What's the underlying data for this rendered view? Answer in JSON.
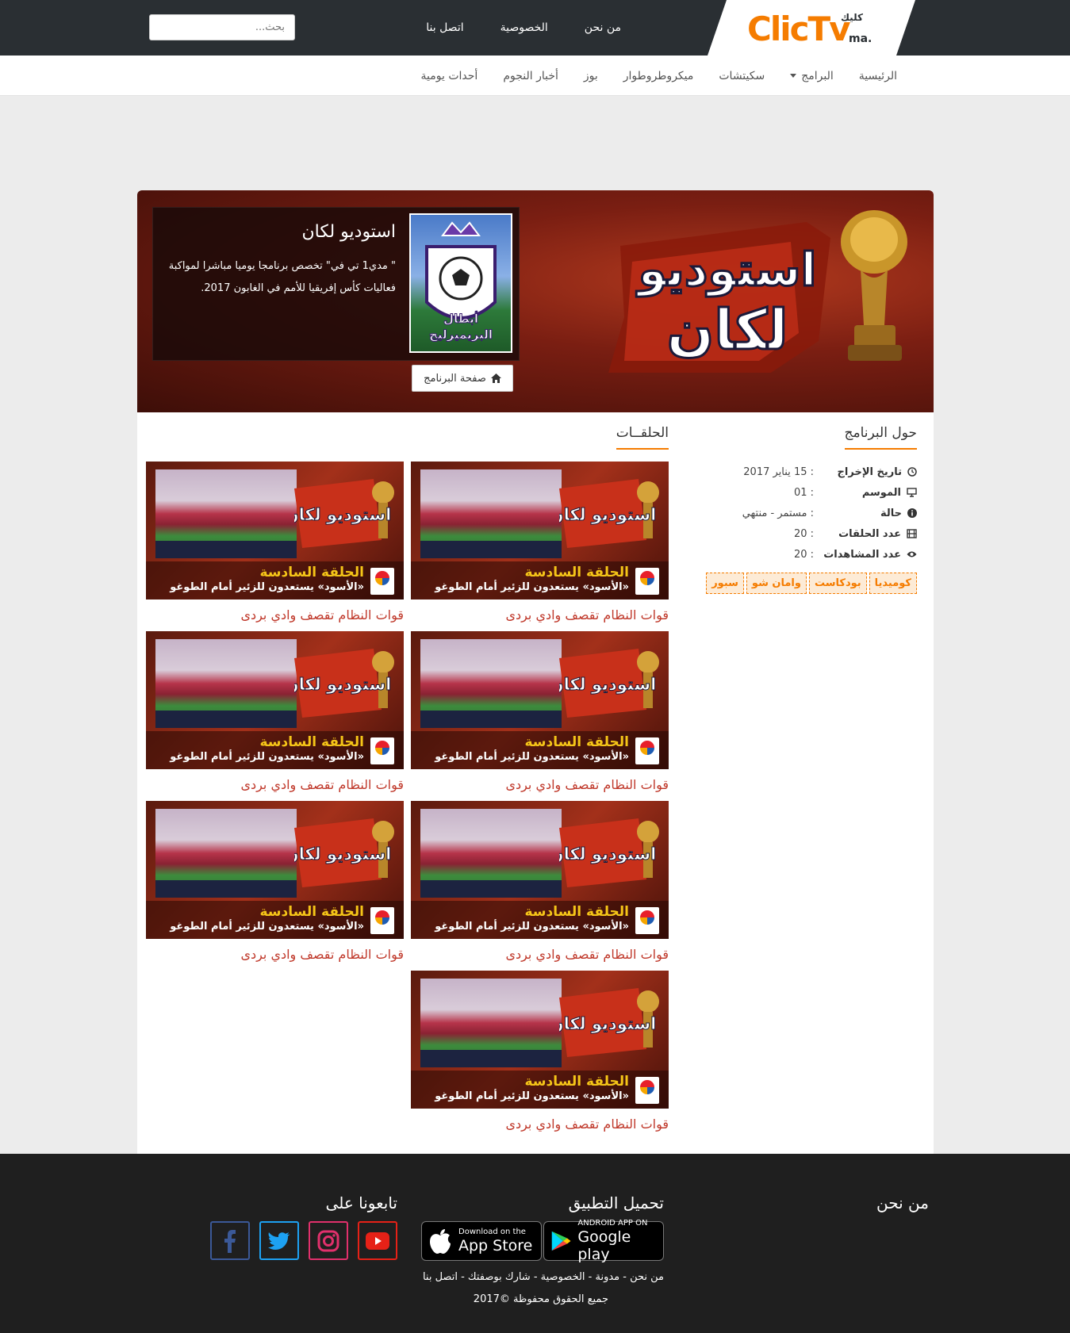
{
  "header": {
    "logo_text": "ClicTv",
    "logo_ma": ".ma",
    "logo_ar": "كليك",
    "links": [
      "من نحن",
      "الخصوصية",
      "اتصل بنا"
    ],
    "search_placeholder": "بحث..."
  },
  "nav": {
    "items": [
      "الرئيسية",
      "البرامج",
      "سكيتشات",
      "ميكروطروطوار",
      "بوز",
      "أخبار النجوم",
      "أحدات يومية"
    ]
  },
  "hero": {
    "title": "استوديو لكان",
    "description": "\" مدي1 تي في\" تخصص برنامجا يوميا مباشرا لمواكبة فعاليات كأس إفريقيا للأمم في الغابون 2017.",
    "button_label": "صفحة البرنامج",
    "art_line1": "استوديو",
    "art_line2": "لكان",
    "thumb_line1": "أبطال",
    "thumb_line2": "البريميرليج"
  },
  "sidebar": {
    "title": "حول البرنامج",
    "info": [
      {
        "label": "تاريخ الإخراج",
        "value": ": 15 يناير 2017",
        "icon": "clock-icon"
      },
      {
        "label": "الموسم",
        "value": ": 01",
        "icon": "monitor-icon"
      },
      {
        "label": "حالة",
        "value": ": مستمر - منتهي",
        "icon": "info-icon"
      },
      {
        "label": "عدد الحلقات",
        "value": ": 20",
        "icon": "film-icon"
      },
      {
        "label": "عدد المشاهدات",
        "value": ": 20",
        "icon": "eye-icon"
      }
    ],
    "tags": [
      "كوميديا",
      "بودكاست",
      "وامان شو",
      "سبور"
    ]
  },
  "episodes": {
    "title": "الحلقــات",
    "items": [
      {
        "caption1": "الحلقة السادسة",
        "caption2": "«الأسود» يستعدون للزئير أمام الطوغو",
        "art": "استوديو لكان",
        "title": "قوات النظام تقصف وادي بردى"
      },
      {
        "caption1": "الحلقة السادسة",
        "caption2": "«الأسود» يستعدون للزئير أمام الطوغو",
        "art": "استوديو لكان",
        "title": "قوات النظام تقصف وادي بردى"
      },
      {
        "caption1": "الحلقة السادسة",
        "caption2": "«الأسود» يستعدون للزئير أمام الطوغو",
        "art": "استوديو لكان",
        "title": "قوات النظام تقصف وادي بردى"
      },
      {
        "caption1": "الحلقة السادسة",
        "caption2": "«الأسود» يستعدون للزئير أمام الطوغو",
        "art": "استوديو لكان",
        "title": "قوات النظام تقصف وادي بردى"
      },
      {
        "caption1": "الحلقة السادسة",
        "caption2": "«الأسود» يستعدون للزئير أمام الطوغو",
        "art": "استوديو لكان",
        "title": "قوات النظام تقصف وادي بردى"
      },
      {
        "caption1": "الحلقة السادسة",
        "caption2": "«الأسود» يستعدون للزئير أمام الطوغو",
        "art": "استوديو لكان",
        "title": "قوات النظام تقصف وادي بردى"
      },
      {
        "caption1": "الحلقة السادسة",
        "caption2": "«الأسود» يستعدون للزئير أمام الطوغو",
        "art": "استوديو لكان",
        "title": "قوات النظام تقصف وادي بردى"
      }
    ]
  },
  "footer": {
    "about_title": "من نحن",
    "app_title": "تحميل التطبيق",
    "follow_title": "تابعونا على",
    "appstore_small": "Download on the",
    "appstore_big": "App Store",
    "googleplay_small": "ANDROID APP ON",
    "googleplay_big": "Google play",
    "links": "من نحن - مدونة - الخصوصية - شارك بوصفتك - اتصل بنا",
    "copyright": "جميع الحقوق محفوظة ©2017",
    "social": [
      {
        "name": "youtube-icon",
        "color": "#e62117"
      },
      {
        "name": "instagram-icon",
        "color": "#e1306c"
      },
      {
        "name": "twitter-icon",
        "color": "#1da1f2"
      },
      {
        "name": "facebook-icon",
        "color": "#3b5998"
      }
    ]
  },
  "colors": {
    "accent": "#f57c00",
    "topbar": "#2a2f33",
    "episode_title": "#c0392b",
    "footer": "#1f1f1f"
  }
}
